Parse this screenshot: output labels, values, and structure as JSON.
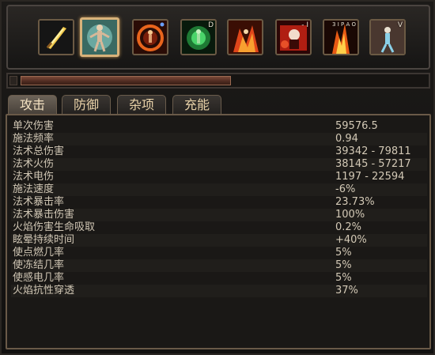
{
  "skills": [
    {
      "name": "sword-skill-icon",
      "key": ""
    },
    {
      "name": "character-portrait-icon",
      "key": ""
    },
    {
      "name": "fire-ring-skill-icon",
      "key": ""
    },
    {
      "name": "green-aura-skill-icon",
      "key": "D"
    },
    {
      "name": "flame-warrior-skill-icon",
      "key": ""
    },
    {
      "name": "red-demon-skill-icon",
      "key": "- I"
    },
    {
      "name": "fire-pillar-skill-icon",
      "key": "3 I P A O"
    },
    {
      "name": "ice-figure-skill-icon",
      "key": "V"
    }
  ],
  "tabs": [
    {
      "label": "攻击",
      "active": true
    },
    {
      "label": "防御",
      "active": false
    },
    {
      "label": "杂项",
      "active": false
    },
    {
      "label": "充能",
      "active": false
    }
  ],
  "stats": [
    {
      "label": "单次伤害",
      "value": "59576.5"
    },
    {
      "label": "施法频率",
      "value": "0.94"
    },
    {
      "label": "法术总伤害",
      "value": "39342 - 79811"
    },
    {
      "label": "法术火伤",
      "value": "38145 - 57217"
    },
    {
      "label": "法术电伤",
      "value": "1197 - 22594"
    },
    {
      "label": "施法速度",
      "value": "-6%"
    },
    {
      "label": "法术暴击率",
      "value": "23.73%"
    },
    {
      "label": "法术暴击伤害",
      "value": "100%"
    },
    {
      "label": "火焰伤害生命吸取",
      "value": "0.2%"
    },
    {
      "label": "眩晕持续时间",
      "value": "+40%"
    },
    {
      "label": "使点燃几率",
      "value": "5%"
    },
    {
      "label": "使冻结几率",
      "value": "5%"
    },
    {
      "label": "使感电几率",
      "value": "5%"
    },
    {
      "label": "火焰抗性穿透",
      "value": "37%"
    }
  ],
  "colors": {
    "frame": "#6a5a48",
    "text": "#d0c6b4",
    "tab_text": "#e9d2a8",
    "slider": "#7b4a38"
  }
}
